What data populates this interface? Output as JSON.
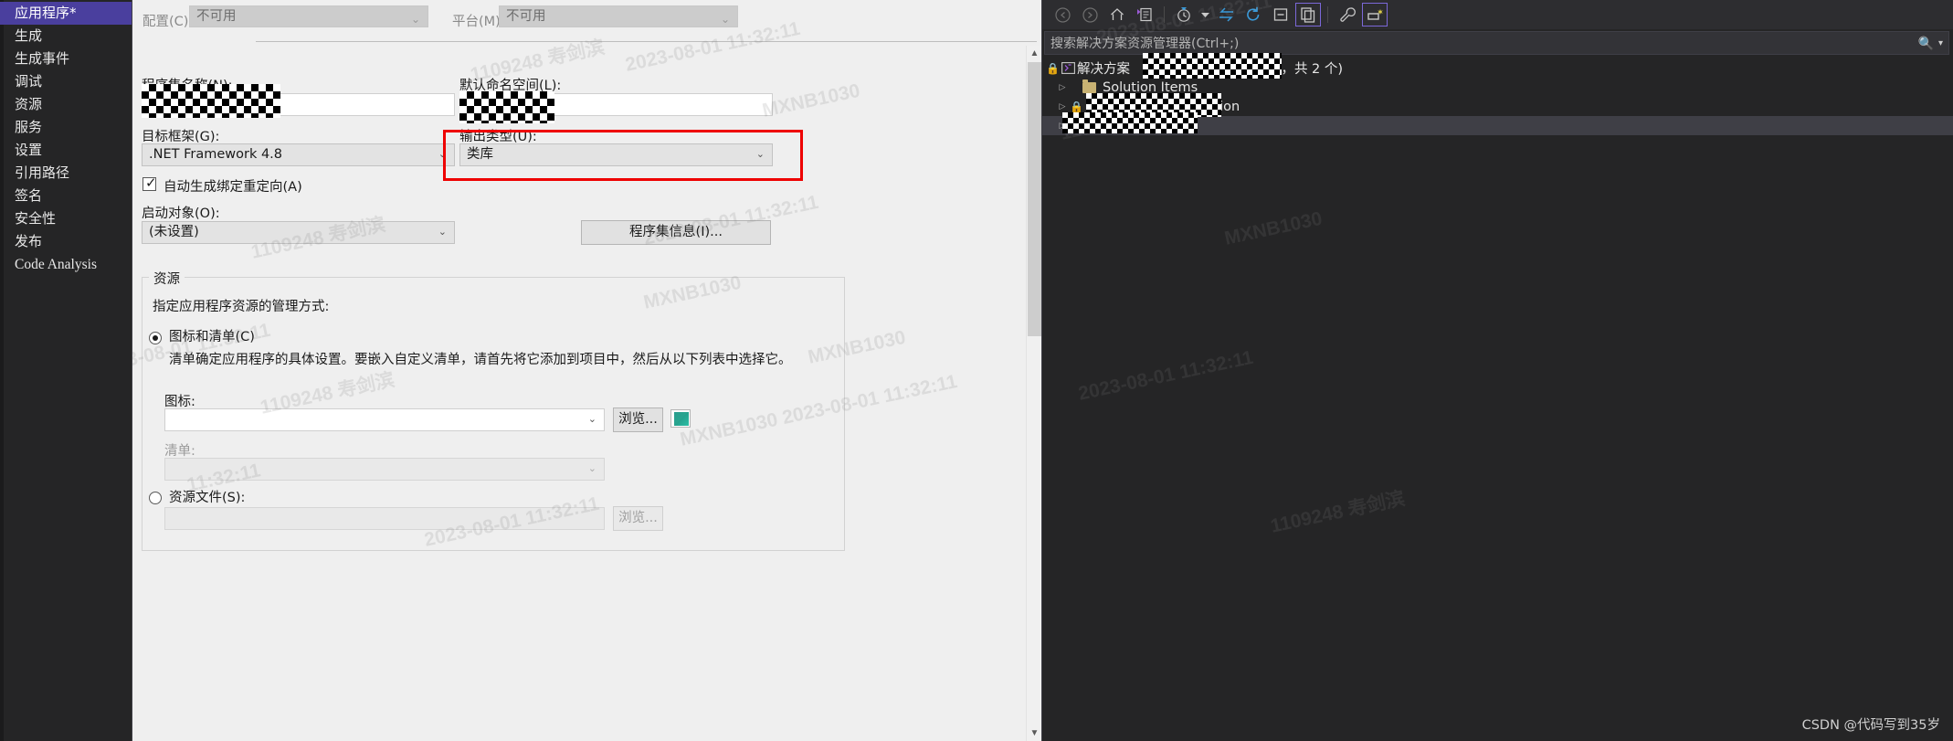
{
  "sidebar": {
    "items": [
      {
        "label": "应用程序*",
        "selected": true,
        "latin": false
      },
      {
        "label": "生成",
        "selected": false,
        "latin": false
      },
      {
        "label": "生成事件",
        "selected": false,
        "latin": false
      },
      {
        "label": "调试",
        "selected": false,
        "latin": false
      },
      {
        "label": "资源",
        "selected": false,
        "latin": false
      },
      {
        "label": "服务",
        "selected": false,
        "latin": false
      },
      {
        "label": "设置",
        "selected": false,
        "latin": false
      },
      {
        "label": "引用路径",
        "selected": false,
        "latin": false
      },
      {
        "label": "签名",
        "selected": false,
        "latin": false
      },
      {
        "label": "安全性",
        "selected": false,
        "latin": false
      },
      {
        "label": "发布",
        "selected": false,
        "latin": false
      },
      {
        "label": "Code Analysis",
        "selected": false,
        "latin": true
      }
    ]
  },
  "config_bar": {
    "configuration_label": "配置(C):",
    "configuration_value": "不可用",
    "platform_label": "平台(M):",
    "platform_value": "不可用"
  },
  "form": {
    "assembly_name_label": "程序集名称(N):",
    "assembly_name_value": "",
    "default_namespace_label": "默认命名空间(L):",
    "default_namespace_value": "nUI",
    "target_framework_label": "目标框架(G):",
    "target_framework_value": ".NET Framework 4.8",
    "output_type_label": "输出类型(U):",
    "output_type_value": "类库",
    "auto_binding_redirect_label": "自动生成绑定重定向(A)",
    "startup_object_label": "启动对象(O):",
    "startup_object_value": "(未设置)",
    "assembly_info_button": "程序集信息(I)..."
  },
  "resources": {
    "group_title": "资源",
    "description": "指定应用程序资源的管理方式:",
    "icon_manifest_radio": "图标和清单(C)",
    "manifest_help": "清单确定应用程序的具体设置。要嵌入自定义清单，请首先将它添加到项目中，然后从以下列表中选择它。",
    "icon_label": "图标:",
    "icon_value": "",
    "browse_icon_button": "浏览...",
    "manifest_label": "清单:",
    "manifest_value": "",
    "resource_file_radio": "资源文件(S):",
    "resource_file_value": "",
    "browse_resource_button": "浏览..."
  },
  "solution_explorer": {
    "toolbar": [
      {
        "name": "back-icon",
        "glyph": "←",
        "dim": true,
        "selected": false
      },
      {
        "name": "forward-icon",
        "glyph": "→",
        "dim": true,
        "selected": false
      },
      {
        "name": "home-icon",
        "glyph": "⌂",
        "dim": false,
        "selected": false
      },
      {
        "name": "pending-changes-icon",
        "glyph": "▤",
        "dim": false,
        "selected": false
      },
      {
        "name": "divider",
        "glyph": "",
        "dim": false,
        "selected": false
      },
      {
        "name": "history-icon",
        "glyph": "◷",
        "dim": false,
        "selected": false
      },
      {
        "name": "dropdown-arrow-icon",
        "glyph": "▾",
        "dim": false,
        "selected": false
      },
      {
        "name": "sync-with-active-document-icon",
        "glyph": "⇆",
        "dim": false,
        "selected": false
      },
      {
        "name": "refresh-icon",
        "glyph": "↻",
        "dim": false,
        "selected": false
      },
      {
        "name": "collapse-all-icon",
        "glyph": "⊟",
        "dim": false,
        "selected": false
      },
      {
        "name": "show-all-files-icon",
        "glyph": "❐",
        "dim": false,
        "selected": true
      },
      {
        "name": "divider2",
        "glyph": "",
        "dim": false,
        "selected": false
      },
      {
        "name": "properties-icon",
        "glyph": "🔧",
        "dim": false,
        "selected": false
      },
      {
        "name": "preview-selected-items-icon",
        "glyph": "▭",
        "dim": false,
        "selected": true
      }
    ],
    "search_placeholder": "搜索解决方案资源管理器(Ctrl+;)",
    "tree": [
      {
        "label": "解决方案",
        "suffix": "个项目，共 2 个)",
        "depth": 0,
        "lock": true,
        "icon": "solution-icon",
        "bold": false,
        "selected": false,
        "twisty": false
      },
      {
        "label": "Solution Items",
        "suffix": "",
        "depth": 1,
        "lock": false,
        "icon": "folder-icon",
        "bold": false,
        "selected": false,
        "twisty": true
      },
      {
        "label": "nApplication",
        "suffix": "",
        "depth": 1,
        "lock": true,
        "icon": "",
        "bold": false,
        "selected": false,
        "twisty": true
      },
      {
        "label": "UI",
        "suffix": "",
        "depth": 1,
        "lock": false,
        "icon": "",
        "bold": true,
        "selected": true,
        "twisty": true
      }
    ]
  },
  "watermarks": [
    "1109248  寿剑滨",
    "2023-08-01  11:32:11",
    "MXNB1030",
    "1109248  寿剑滨",
    "2023-08-01  11:32:11",
    "MXNB1030",
    "1109248  寿剑滨",
    "11:32:11",
    "MXNB1030",
    "2023-08-01  11:32:11",
    "1109248  寿剑滨",
    "MXNB1030  2023-08-01  11:32:11",
    "1109248  寿剑滨"
  ],
  "attribution": "CSDN @代码写到35岁",
  "colors": {
    "accent_purple": "#4a3f9e",
    "highlight_red": "#ee0000",
    "panel_dark": "#252526",
    "panel_light": "#efefef",
    "toolbar_select": "#7b68d8"
  }
}
